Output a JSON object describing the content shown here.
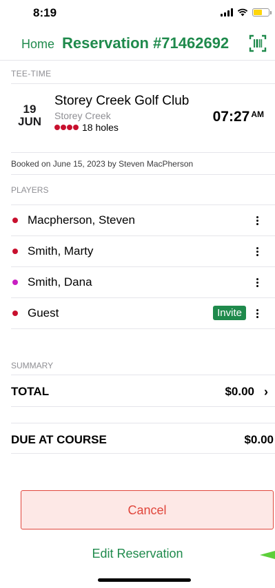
{
  "status_bar": {
    "time": "8:19"
  },
  "header": {
    "home_label": "Home",
    "title": "Reservation #71462692",
    "barcode_icon": "barcode-scan-icon"
  },
  "teetime": {
    "section_label": "TEE-TIME",
    "day": "19",
    "month": "JUN",
    "course_name": "Storey Creek Golf Club",
    "course_sub": "Storey Creek",
    "holes": "18 holes",
    "hole_dot_colors": [
      "#c8102e",
      "#c8102e",
      "#c8102e",
      "#c8102e"
    ],
    "time": "07:27",
    "ampm": "AM"
  },
  "booked": "Booked on June 15, 2023 by Steven MacPherson",
  "players": {
    "section_label": "PLAYERS",
    "items": [
      {
        "name": "Macpherson, Steven",
        "dot_color": "#c8102e"
      },
      {
        "name": "Smith, Marty",
        "dot_color": "#c8102e"
      },
      {
        "name": "Smith, Dana",
        "dot_color": "#c81ec2"
      },
      {
        "name": "Guest",
        "dot_color": "#c8102e",
        "invite_label": "Invite"
      }
    ]
  },
  "summary": {
    "section_label": "SUMMARY",
    "total_label": "TOTAL",
    "total_value": "$0.00",
    "due_label": "DUE AT COURSE",
    "due_value": "$0.00"
  },
  "actions": {
    "cancel_label": "Cancel",
    "edit_label": "Edit Reservation"
  },
  "colors": {
    "accent": "#1f8a4c",
    "danger": "#e0453b",
    "danger_bg": "#fde8e6"
  }
}
